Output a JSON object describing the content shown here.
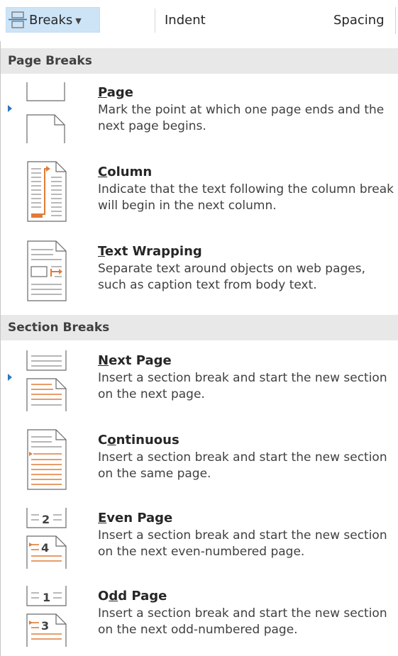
{
  "ribbon": {
    "breaks_label": "Breaks",
    "indent_label": "Indent",
    "spacing_label": "Spacing"
  },
  "menu": {
    "page_breaks_header": "Page Breaks",
    "section_breaks_header": "Section Breaks",
    "items": [
      {
        "key": "P",
        "rest": "age",
        "pre": "",
        "desc": "Mark the point at which one page ends and the next page begins."
      },
      {
        "key": "C",
        "rest": "olumn",
        "pre": "",
        "desc": "Indicate that the text following the column break will begin in the next column."
      },
      {
        "key": "T",
        "rest": "ext Wrapping",
        "pre": "",
        "desc": "Separate text around objects on web pages, such as caption text from body text."
      },
      {
        "key": "N",
        "rest": "ext Page",
        "pre": "",
        "desc": "Insert a section break and start the new section on the next page."
      },
      {
        "key": "o",
        "rest": "ntinuous",
        "pre": "C",
        "desc": "Insert a section break and start the new section on the same page."
      },
      {
        "key": "E",
        "rest": "ven Page",
        "pre": "",
        "desc": "Insert a section break and start the new section on the next even-numbered page."
      },
      {
        "key": "d",
        "rest": "d Page",
        "pre": "O",
        "desc": "Insert a section break and start the new section on the next odd-numbered page."
      }
    ],
    "even_icon_numbers": [
      "2",
      "4"
    ],
    "odd_icon_numbers": [
      "1",
      "3"
    ]
  },
  "colors": {
    "accent_orange": "#e07b39",
    "selected_button_bg": "#cde4f7",
    "header_bg": "#e8e8e8",
    "pointer_blue": "#2b79c2"
  },
  "icons": [
    "page-break-icon",
    "column-break-icon",
    "text-wrapping-icon",
    "next-page-icon",
    "continuous-icon",
    "even-page-icon",
    "odd-page-icon"
  ]
}
